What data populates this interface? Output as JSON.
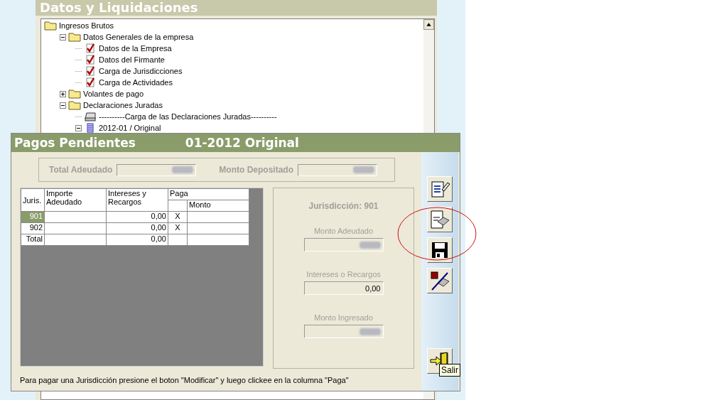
{
  "main_window": {
    "title": "Datos y Liquidaciones",
    "tree": [
      {
        "label": "Ingresos Brutos",
        "kind": "folder",
        "children": [
          {
            "label": "Datos Generales de la empresa",
            "kind": "folder",
            "expanded": true,
            "children": [
              {
                "label": "Datos de la Empresa",
                "kind": "check"
              },
              {
                "label": "Datos del Firmante",
                "kind": "check"
              },
              {
                "label": "Carga de Jurisdicciones",
                "kind": "check"
              },
              {
                "label": "Carga de Actividades",
                "kind": "check"
              }
            ]
          },
          {
            "label": "Volantes de pago",
            "kind": "folder",
            "expanded": false
          },
          {
            "label": "Declaraciones Juradas",
            "kind": "folder",
            "expanded": true,
            "children": [
              {
                "label": "----------Carga de las Declaraciones Juradas----------",
                "kind": "tray"
              },
              {
                "label": "2012-01 / Original",
                "kind": "doc",
                "expanded": true
              }
            ]
          }
        ]
      }
    ]
  },
  "dialog": {
    "title": "Pagos Pendientes",
    "period": "01-2012 Original",
    "totals": [
      {
        "label": "Total Adeudado",
        "redacted": true
      },
      {
        "label": "Monto Depositado",
        "redacted": true
      }
    ],
    "table": {
      "columns": [
        "Juris.",
        "Importe Adeudado",
        "Intereses y Recargos"
      ],
      "group": "Paga",
      "subcolumns": [
        "Monto"
      ],
      "rows": [
        {
          "juris": "901",
          "intereses": "0,00",
          "paga": "X",
          "selected": true
        },
        {
          "juris": "902",
          "intereses": "0,00",
          "paga": "X",
          "selected": false
        },
        {
          "juris": "Total",
          "intereses": "0,00",
          "selected": false
        }
      ]
    },
    "detail": {
      "title": "Jurisdicción: 901",
      "fields": [
        {
          "label": "Monto Adeudado",
          "redacted": true
        },
        {
          "label": "Intereses o Recargos",
          "value": "0,00"
        },
        {
          "label": "Monto Ingresado",
          "redacted": true
        }
      ]
    },
    "toolbar": [
      {
        "kind": "edit"
      },
      {
        "kind": "print"
      },
      {
        "kind": "save"
      },
      {
        "kind": "cancel-print"
      },
      {
        "kind": "exit",
        "tooltip": "Salir"
      }
    ],
    "hint": "Para pagar una Jurisdicción presione el boton \"Modificar\" y luego clickee en la columna \"Paga\""
  }
}
